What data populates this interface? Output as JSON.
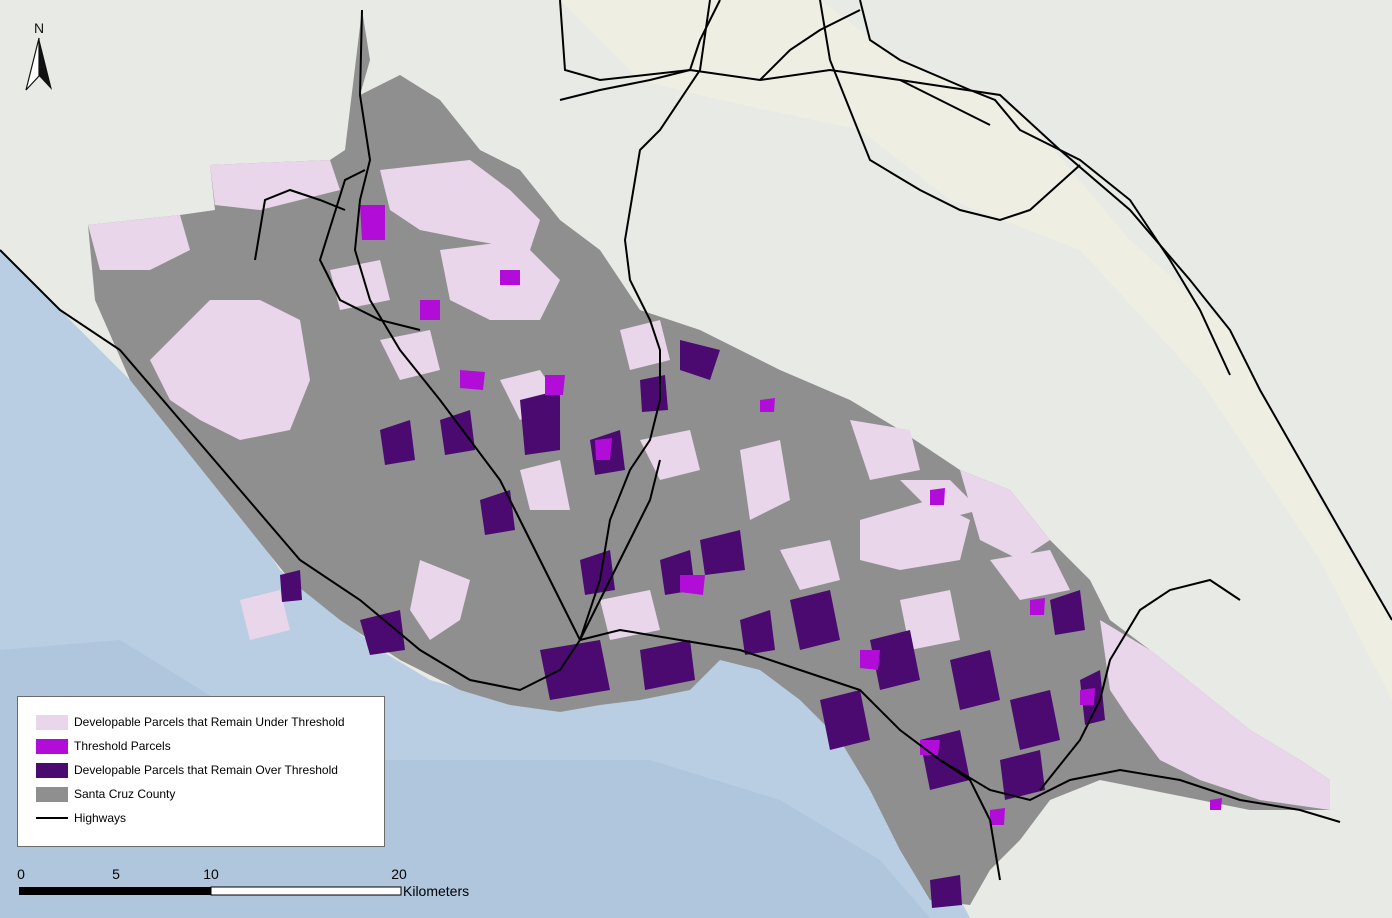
{
  "map": {
    "north_label": "N",
    "legend": {
      "items": [
        {
          "label": "Developable Parcels that Remain Under Threshold",
          "color": "#ead6ea",
          "kind": "fill"
        },
        {
          "label": "Threshold Parcels",
          "color": "#b20cd8",
          "kind": "fill"
        },
        {
          "label": "Developable Parcels that Remain Over Threshold",
          "color": "#4a0a70",
          "kind": "fill"
        },
        {
          "label": "Santa Cruz County",
          "color": "#8f8f8f",
          "kind": "fill"
        },
        {
          "label": "Highways",
          "color": "#000000",
          "kind": "line"
        }
      ]
    },
    "scale": {
      "ticks": [
        "0",
        "5",
        "10",
        "20"
      ],
      "units": "Kilometers"
    },
    "colors": {
      "ocean": "#b7cde2",
      "land": "#e6e9e4",
      "county": "#8f8f8f",
      "under": "#ead6ea",
      "threshold": "#b20cd8",
      "over": "#4a0a70",
      "highway": "#000000"
    }
  }
}
